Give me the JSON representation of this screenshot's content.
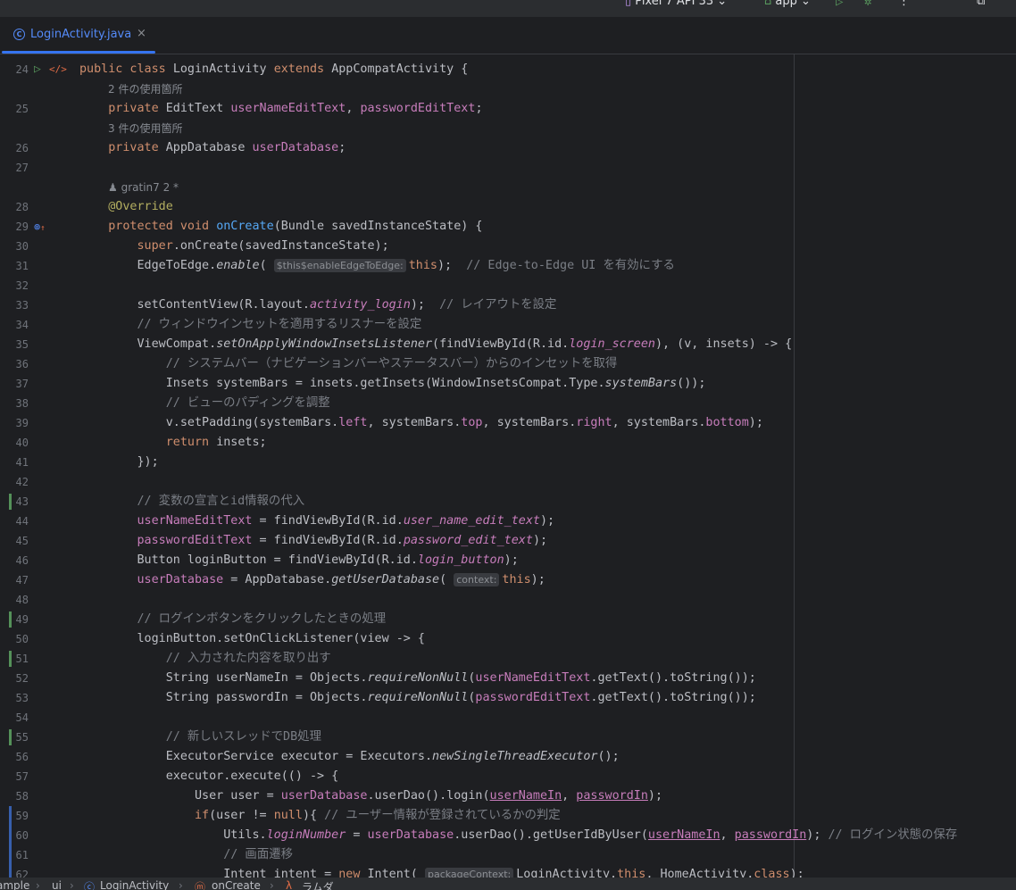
{
  "toolbar": {
    "device": "Pixel 7 API 33",
    "run_config": "app"
  },
  "tab": {
    "label": "LoginActivity.java",
    "close": "×"
  },
  "hints": {
    "usages_2": "2 件の使用箇所",
    "usages_3": "3 件の使用箇所",
    "author": "gratin7 2 *"
  },
  "inlays": {
    "this_enable": "$this$enableEdgeToEdge:",
    "context": "context:",
    "package_context": "packageContext:"
  },
  "breadcrumbs": [
    "ample",
    "ui",
    "LoginActivity",
    "onCreate",
    "ラムダ"
  ],
  "gutter_changes": [
    43,
    49,
    51,
    55,
    59,
    60,
    61,
    62
  ],
  "code_lines": [
    {
      "ln": "24",
      "text": "public class LoginActivity extends AppCompatActivity {"
    },
    {
      "ln": "25",
      "text": "    private EditText userNameEditText, passwordEditText;"
    },
    {
      "ln": "26",
      "text": "    private AppDatabase userDatabase;"
    },
    {
      "ln": "27",
      "text": ""
    },
    {
      "ln": "28",
      "text": "    @Override"
    },
    {
      "ln": "29",
      "text": "    protected void onCreate(Bundle savedInstanceState) {"
    },
    {
      "ln": "30",
      "text": "        super.onCreate(savedInstanceState);"
    },
    {
      "ln": "31",
      "text": "        EdgeToEdge.enable(this);  // Edge-to-Edge UI を有効にする"
    },
    {
      "ln": "32",
      "text": ""
    },
    {
      "ln": "33",
      "text": "        setContentView(R.layout.activity_login);  // レイアウトを設定"
    },
    {
      "ln": "34",
      "text": "        // ウィンドウインセットを適用するリスナーを設定"
    },
    {
      "ln": "35",
      "text": "        ViewCompat.setOnApplyWindowInsetsListener(findViewById(R.id.login_screen), (v, insets) -> {"
    },
    {
      "ln": "36",
      "text": "            // システムバー（ナビゲーションバーやステータスバー）からのインセットを取得"
    },
    {
      "ln": "37",
      "text": "            Insets systemBars = insets.getInsets(WindowInsetsCompat.Type.systemBars());"
    },
    {
      "ln": "38",
      "text": "            // ビューのパディングを調整"
    },
    {
      "ln": "39",
      "text": "            v.setPadding(systemBars.left, systemBars.top, systemBars.right, systemBars.bottom);"
    },
    {
      "ln": "40",
      "text": "            return insets;"
    },
    {
      "ln": "41",
      "text": "        });"
    },
    {
      "ln": "42",
      "text": ""
    },
    {
      "ln": "43",
      "text": "        // 変数の宣言とid情報の代入"
    },
    {
      "ln": "44",
      "text": "        userNameEditText = findViewById(R.id.user_name_edit_text);"
    },
    {
      "ln": "45",
      "text": "        passwordEditText = findViewById(R.id.password_edit_text);"
    },
    {
      "ln": "46",
      "text": "        Button loginButton = findViewById(R.id.login_button);"
    },
    {
      "ln": "47",
      "text": "        userDatabase = AppDatabase.getUserDatabase(this);"
    },
    {
      "ln": "48",
      "text": ""
    },
    {
      "ln": "49",
      "text": "        // ログインボタンをクリックしたときの処理"
    },
    {
      "ln": "50",
      "text": "        loginButton.setOnClickListener(view -> {"
    },
    {
      "ln": "51",
      "text": "            // 入力された内容を取り出す"
    },
    {
      "ln": "52",
      "text": "            String userNameIn = Objects.requireNonNull(userNameEditText.getText().toString());"
    },
    {
      "ln": "53",
      "text": "            String passwordIn = Objects.requireNonNull(passwordEditText.getText().toString());"
    },
    {
      "ln": "54",
      "text": ""
    },
    {
      "ln": "55",
      "text": "            // 新しいスレッドでDB処理"
    },
    {
      "ln": "56",
      "text": "            ExecutorService executor = Executors.newSingleThreadExecutor();"
    },
    {
      "ln": "57",
      "text": "            executor.execute(() -> {"
    },
    {
      "ln": "58",
      "text": "                User user = userDatabase.userDao().login(userNameIn, passwordIn);"
    },
    {
      "ln": "59",
      "text": "                if(user != null){ // ユーザー情報が登録されているかの判定"
    },
    {
      "ln": "60",
      "text": "                    Utils.loginNumber = userDatabase.userDao().getUserIdByUser(userNameIn, passwordIn); // ログイン状態の保存"
    },
    {
      "ln": "61",
      "text": "                    // 画面遷移"
    },
    {
      "ln": "62",
      "text": "                    Intent intent = new Intent(LoginActivity.this, HomeActivity.class);"
    }
  ],
  "colors": {
    "background": "#1e1f22",
    "keyword": "#cf8e6d",
    "field": "#c77dbb",
    "function": "#56a8f5",
    "comment": "#7a7e85",
    "annotation": "#b3ae60",
    "accent": "#3574f0",
    "change_marker": "#549159"
  }
}
